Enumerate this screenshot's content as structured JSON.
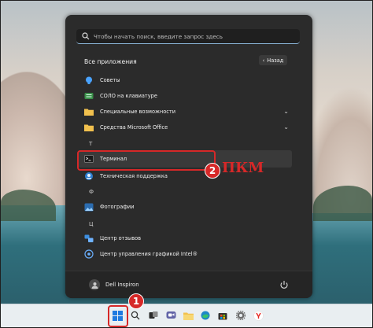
{
  "start_menu": {
    "search_placeholder": "Чтобы начать поиск, введите запрос здесь",
    "section_title": "Все приложения",
    "back_label": "Назад",
    "apps": [
      {
        "label": "Советы",
        "icon": "tips-icon"
      },
      {
        "label": "СОЛО на клавиатуре",
        "icon": "keyboard-icon"
      },
      {
        "label": "Специальные возможности",
        "icon": "folder-icon"
      },
      {
        "label": "Средства Microsoft Office",
        "icon": "folder-icon"
      },
      {
        "label": "Терминал",
        "icon": "terminal-icon"
      },
      {
        "label": "Техническая поддержка",
        "icon": "support-icon"
      },
      {
        "label": "Фотографии",
        "icon": "photos-icon"
      },
      {
        "label": "Центр отзывов",
        "icon": "feedback-icon"
      },
      {
        "label": "Центр управления графикой Intel®",
        "icon": "intel-graphics-icon"
      }
    ],
    "letters": [
      "Т",
      "Ф",
      "Ц"
    ],
    "user_name": "Dell Inspiron"
  },
  "annotations": {
    "step1": "1",
    "step2": "2",
    "step2_text": "ПКМ",
    "color": "#d62828"
  },
  "taskbar": {
    "icons": [
      "windows-start-icon",
      "search-icon",
      "task-view-icon",
      "teams-chat-icon",
      "file-explorer-icon",
      "edge-icon",
      "store-icon",
      "settings-icon",
      "yandex-browser-icon"
    ]
  }
}
